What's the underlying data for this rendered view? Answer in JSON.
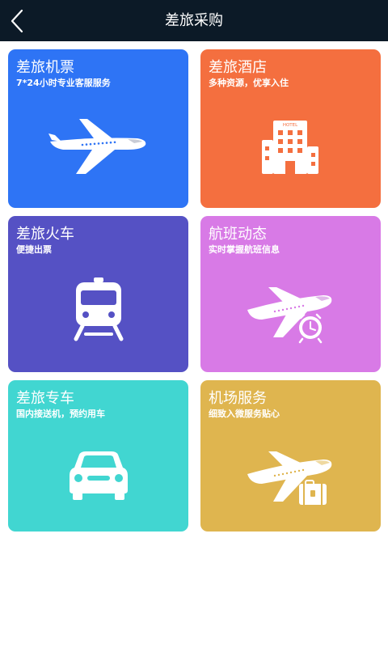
{
  "header": {
    "title": "差旅采购",
    "back_icon": "chevron-left-icon"
  },
  "tiles": [
    {
      "title": "差旅机票",
      "subtitle": "7*24小时专业客服服务",
      "color": "#2e74f5",
      "icon": "airplane-icon"
    },
    {
      "title": "差旅酒店",
      "subtitle": "多种资源，优享入住",
      "color": "#f46f3f",
      "icon": "hotel-icon",
      "icon_text": "HOTEL"
    },
    {
      "title": "差旅火车",
      "subtitle": "便捷出票",
      "color": "#5551c4",
      "icon": "train-icon"
    },
    {
      "title": "航班动态",
      "subtitle": "实时掌握航班信息",
      "color": "#d87ae6",
      "icon": "airplane-clock-icon"
    },
    {
      "title": "差旅专车",
      "subtitle": "国内接送机，预约用车",
      "color": "#41d6d1",
      "icon": "car-icon"
    },
    {
      "title": "机场服务",
      "subtitle": "细致入微服务贴心",
      "color": "#dfb54f",
      "icon": "airplane-luggage-icon"
    }
  ]
}
